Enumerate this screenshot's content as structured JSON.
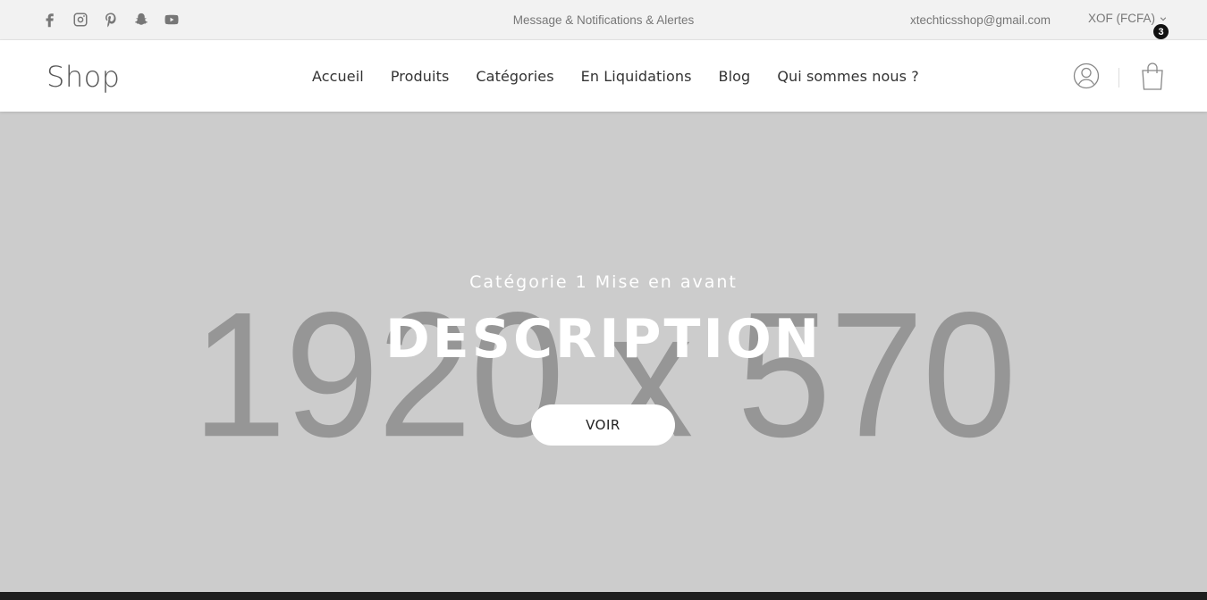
{
  "topbar": {
    "social": [
      {
        "icon": "facebook-icon"
      },
      {
        "icon": "instagram-icon"
      },
      {
        "icon": "pinterest-icon"
      },
      {
        "icon": "snapchat-icon"
      },
      {
        "icon": "youtube-icon"
      }
    ],
    "message": "Message & Notifications & Alertes",
    "email": "xtechticsshop@gmail.com",
    "currency": "XOF (FCFA)"
  },
  "header": {
    "logo": "Shop",
    "nav": [
      "Accueil",
      "Produits",
      "Catégories",
      "En Liquidations",
      "Blog",
      "Qui sommes nous ?"
    ],
    "cart_count": "3"
  },
  "hero": {
    "placeholder": "1920 x 570",
    "subtitle": "Catégorie 1 Mise en avant",
    "title": "DESCRIPTION",
    "button": "VOIR"
  },
  "colors": {
    "hero_bg": "#cccccc",
    "topbar_bg": "#f2f2f2",
    "badge": "#111111"
  }
}
